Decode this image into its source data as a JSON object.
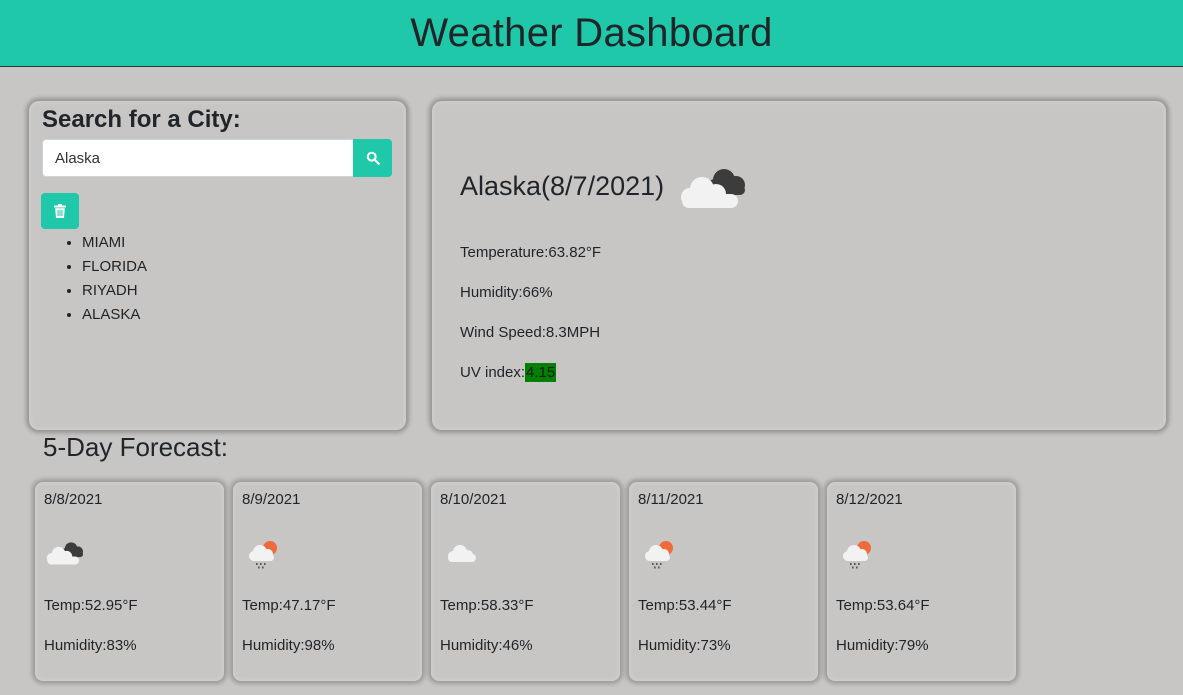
{
  "header": {
    "title": "Weather Dashboard"
  },
  "colors": {
    "accent": "#1ec8a9",
    "background": "#c8c6c5",
    "uv_good": "#008000"
  },
  "search": {
    "title": "Search for a City:",
    "value": "Alaska",
    "button_icon": "search-icon",
    "clear_icon": "trash-icon",
    "history": [
      "MIAMI",
      "FLORIDA",
      "RIYADH",
      "ALASKA"
    ]
  },
  "current": {
    "city": "Alaska(8/7/2021)",
    "icon": "broken-clouds-icon",
    "temperature": "Temperature:63.82°F",
    "humidity": "Humidity:66%",
    "wind": "Wind Speed:8.3MPH",
    "uv_label": "UV index:",
    "uv_value": "4.15"
  },
  "forecast": {
    "title": "5-Day Forecast:",
    "days": [
      {
        "date": "8/8/2021",
        "icon": "broken-clouds-icon",
        "temp": "Temp:52.95°F",
        "humidity": "Humidity:83%"
      },
      {
        "date": "8/9/2021",
        "icon": "rain-sun-icon",
        "temp": "Temp:47.17°F",
        "humidity": "Humidity:98%"
      },
      {
        "date": "8/10/2021",
        "icon": "cloud-icon",
        "temp": "Temp:58.33°F",
        "humidity": "Humidity:46%"
      },
      {
        "date": "8/11/2021",
        "icon": "rain-sun-icon",
        "temp": "Temp:53.44°F",
        "humidity": "Humidity:73%"
      },
      {
        "date": "8/12/2021",
        "icon": "rain-sun-icon",
        "temp": "Temp:53.64°F",
        "humidity": "Humidity:79%"
      }
    ]
  }
}
